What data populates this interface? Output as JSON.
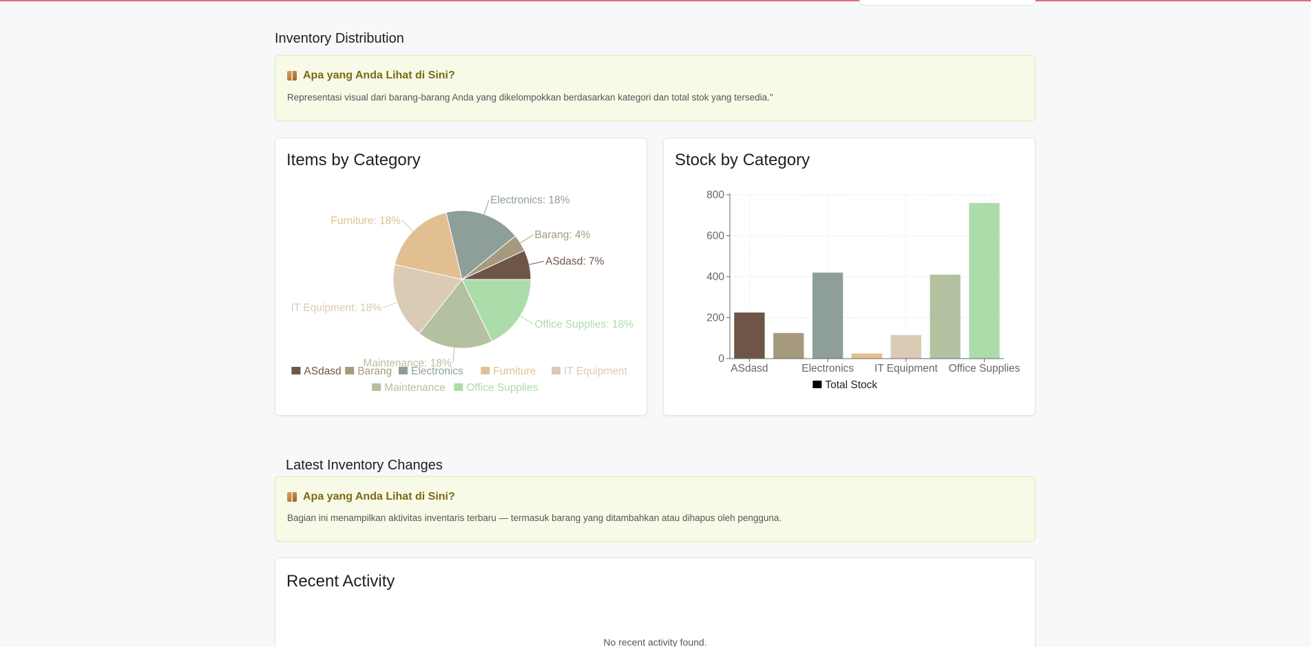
{
  "distribution": {
    "title": "Inventory Distribution",
    "info": {
      "heading": "Apa yang Anda Lihat di Sini?",
      "text": "Representasi visual dari barang-barang Anda yang dikelompokkan berdasarkan kategori dan total stok yang tersedia.\""
    }
  },
  "pie_card": {
    "title": "Items by Category"
  },
  "bar_card": {
    "title": "Stock by Category"
  },
  "latest": {
    "title": "Latest Inventory Changes",
    "info": {
      "heading": "Apa yang Anda Lihat di Sini?",
      "text": "Bagian ini menampilkan aktivitas inventaris terbaru — termasuk barang yang ditambahkan atau dihapus oleh pengguna."
    }
  },
  "recent": {
    "title": "Recent Activity",
    "empty_text": "No recent activity found."
  },
  "colors": {
    "accent_line": "#e5677a",
    "info_bg": "#f8fae8",
    "info_heading": "#7a6a14"
  },
  "icons": {
    "info_icon": "package-icon"
  },
  "chart_data": [
    {
      "type": "pie",
      "title": "Items by Category",
      "categories": [
        "ASdasd",
        "Barang",
        "Electronics",
        "Furniture",
        "IT Equipment",
        "Maintenance",
        "Office Supplies"
      ],
      "values": [
        7,
        4,
        18,
        18,
        18,
        18,
        18
      ],
      "labels": [
        "ASdasd: 7%",
        "Barang: 4%",
        "Electronics: 18%",
        "Furniture: 18%",
        "IT Equipment: 18%",
        "Maintenance: 18%",
        "Office Supplies: 18%"
      ],
      "colors": [
        "#6e5548",
        "#a59a7d",
        "#8e9f9a",
        "#e2bf91",
        "#d9cbb4",
        "#b4c1a1",
        "#acdcaa"
      ],
      "legend": "bottom"
    },
    {
      "type": "bar",
      "title": "Stock by Category",
      "categories": [
        "ASdasd",
        "Barang",
        "Electronics",
        "Furniture",
        "IT Equipment",
        "Maintenance",
        "Office Supplies"
      ],
      "tick_labels": [
        "ASdasd",
        "Electronics",
        "IT Equipment",
        "Office Supplies"
      ],
      "series": [
        {
          "name": "Total Stock",
          "values": [
            225,
            125,
            420,
            25,
            115,
            410,
            760
          ]
        }
      ],
      "colors": [
        "#6e5548",
        "#a59a7d",
        "#8e9f9a",
        "#e2bf91",
        "#d9cbb4",
        "#b4c1a1",
        "#acdcaa"
      ],
      "ylim": [
        0,
        800
      ],
      "yticks": [
        0,
        200,
        400,
        600,
        800
      ],
      "grid": true,
      "legend": "bottom"
    }
  ]
}
